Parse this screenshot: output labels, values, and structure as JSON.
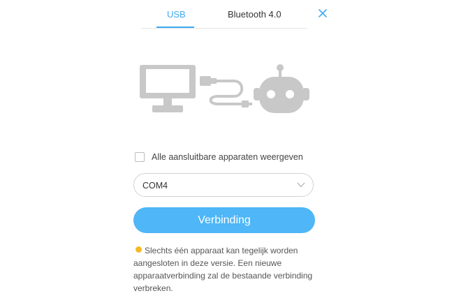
{
  "tabs": [
    {
      "label": "USB",
      "active": true
    },
    {
      "label": "Bluetooth 4.0",
      "active": false
    }
  ],
  "close_icon": "close-icon",
  "illustration": {
    "icons": [
      "monitor-icon",
      "usb-cable-icon",
      "robot-icon"
    ],
    "color": "#c8c8c8"
  },
  "checkbox": {
    "label": "Alle aansluitbare apparaten weergeven",
    "checked": false
  },
  "port_select": {
    "value": "COM4",
    "icon": "chevron-down-icon"
  },
  "connect_button": {
    "label": "Verbinding",
    "color": "#4fb6f7"
  },
  "notice": {
    "icon": "warning-dot-icon",
    "color": "#f5b829",
    "text": "Slechts één apparaat kan tegelijk worden aangesloten in deze versie. Een nieuwe apparaatverbinding zal de bestaande verbinding verbreken."
  },
  "colors": {
    "accent": "#3eaaf0",
    "text": "#333333"
  }
}
